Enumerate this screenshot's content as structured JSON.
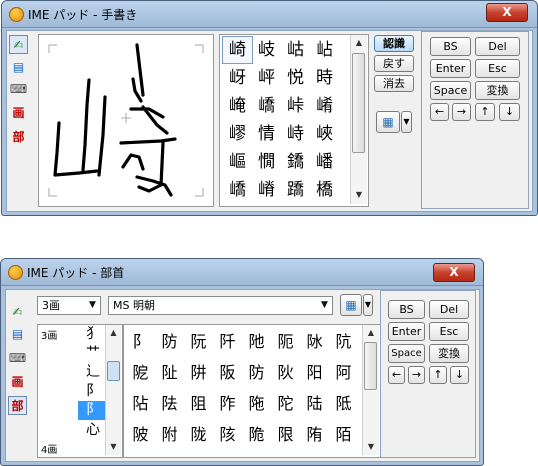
{
  "top": {
    "title": "IME パッド - 手書き",
    "close": "X",
    "left_tools": [
      "✍",
      "▤",
      "⌨",
      "画",
      "部"
    ],
    "candidates": [
      [
        "崎",
        "岐",
        "岵",
        "岾"
      ],
      [
        "岈",
        "岼",
        "悦",
        "時"
      ],
      [
        "崦",
        "嶠",
        "峠",
        "崤"
      ],
      [
        "嵺",
        "情",
        "峙",
        "峽"
      ],
      [
        "嶇",
        "憪",
        "鐈",
        "嶓"
      ],
      [
        "嶠",
        "嵴",
        "蹻",
        "橋"
      ]
    ],
    "side_buttons": {
      "recognize": "認識",
      "back": "戻す",
      "erase": "消去"
    },
    "keys": {
      "bs": "BS",
      "del": "Del",
      "enter": "Enter",
      "esc": "Esc",
      "space": "Space",
      "convert": "変換",
      "left": "←",
      "right": "→",
      "up": "↑",
      "down": "↓"
    }
  },
  "bottom": {
    "title": "IME パッド - 部首",
    "close": "X",
    "left_tools": [
      "✍",
      "▤",
      "⌨",
      "画",
      "部"
    ],
    "stroke_select": "3画",
    "font_select": "MS 明朝",
    "stroke_label_top": "3画",
    "stroke_label_bottom": "4画",
    "radicals": [
      "犭",
      "艹",
      "辶",
      "阝",
      "阝",
      "心"
    ],
    "candidates": [
      [
        "阝",
        "防",
        "阮",
        "阡",
        "阤",
        "阨",
        "阥",
        "阬"
      ],
      [
        "阸",
        "阯",
        "阱",
        "阪",
        "防",
        "阦",
        "阳",
        "阿"
      ],
      [
        "阽",
        "阹",
        "阻",
        "阼",
        "陁",
        "陀",
        "陆",
        "阺"
      ],
      [
        "陂",
        "附",
        "陇",
        "陔",
        "陒",
        "限",
        "陏",
        "陌"
      ]
    ],
    "keys": {
      "bs": "BS",
      "del": "Del",
      "enter": "Enter",
      "esc": "Esc",
      "space": "Space",
      "convert": "変換",
      "left": "←",
      "right": "→",
      "up": "↑",
      "down": "↓"
    }
  }
}
